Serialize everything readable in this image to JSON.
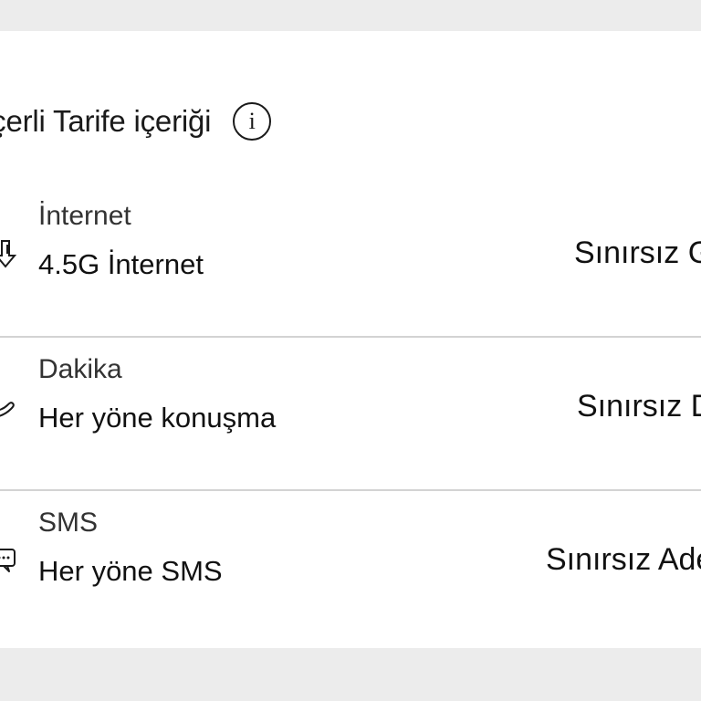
{
  "section": {
    "title": "eçerli Tarife içeriği",
    "info_icon": "info-icon",
    "info_glyph": "i"
  },
  "rows": [
    {
      "label": "İnternet",
      "description": "4.5G İnternet",
      "value": "Sınırsız G",
      "icon": "data-download-icon"
    },
    {
      "label": "Dakika",
      "description": "Her yöne konuşma",
      "value": "Sınırsız D",
      "icon": "phone-icon"
    },
    {
      "label": "SMS",
      "description": "Her yöne SMS",
      "value": "Sınırsız Ade",
      "icon": "chat-bubbles-icon"
    }
  ],
  "colors": {
    "background": "#ececec",
    "card": "#ffffff",
    "text": "#1a1a1a",
    "divider": "#d3d3d3"
  }
}
